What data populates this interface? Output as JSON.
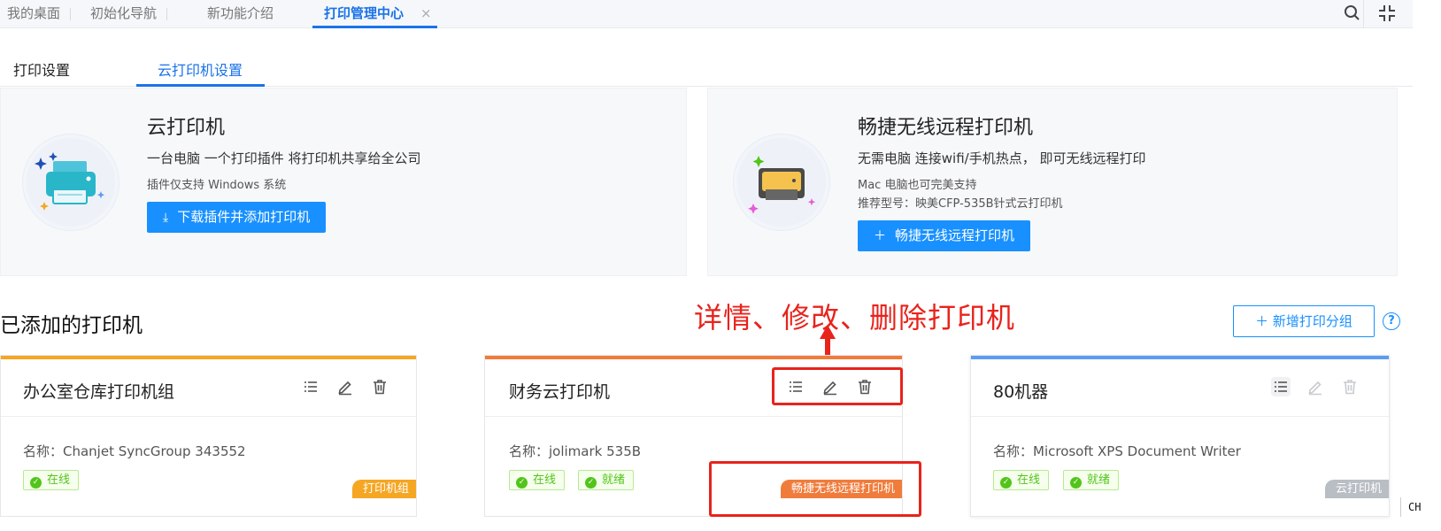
{
  "top_tabs": [
    {
      "label": "我的桌面",
      "active": false
    },
    {
      "label": "初始化导航",
      "active": false
    },
    {
      "label": "新功能介绍",
      "active": false
    },
    {
      "label": "打印管理中心",
      "active": true
    }
  ],
  "top_tab_close": "×",
  "top_icons": [
    "search-icon",
    "fullscreen-exit-icon"
  ],
  "sub_tabs": [
    {
      "label": "打印设置",
      "active": false
    },
    {
      "label": "云打印机设置",
      "active": true
    }
  ],
  "promos": {
    "cloud": {
      "title": "云打印机",
      "desc": "一台电脑 一个打印插件 将打印机共享给全公司",
      "note": "插件仅支持 Windows 系统",
      "button": "下载插件并添加打印机",
      "button_icon": "download-icon"
    },
    "wireless": {
      "title": "畅捷无线远程打印机",
      "desc": "无需电脑 连接wifi/手机热点， 即可无线远程打印",
      "note1": "Mac 电脑也可完美支持",
      "note2": "推荐型号：映美CFP-535B针式云打印机",
      "button": "畅捷无线远程打印机",
      "button_icon": "plus-icon"
    }
  },
  "section_title": "已添加的打印机",
  "annotation": "详情、修改、删除打印机",
  "add_group_button": "新增打印分组",
  "help_icon": "?",
  "cards": [
    {
      "title": "办公室仓库打印机组",
      "name": "名称：Chanjet SyncGroup 343552",
      "badges": [
        "在线"
      ],
      "tag": "打印机组",
      "accent": "#f5a623",
      "tag_color": "#f5a623"
    },
    {
      "title": "财务云打印机",
      "name": "名称：jolimark 535B",
      "badges": [
        "在线",
        "就绪"
      ],
      "tag": "畅捷无线远程打印机",
      "accent": "#f07c3c",
      "tag_color": "#f07c3c"
    },
    {
      "title": "80机器",
      "name": "名称：Microsoft XPS Document Writer",
      "badges": [
        "在线",
        "就绪"
      ],
      "tag": "云打印机",
      "accent": "#5b9cf0",
      "tag_color": "#b9bdc4"
    }
  ],
  "ime_indicator": "CH",
  "colors": {
    "primary": "#1890ff",
    "annotation_red": "#e8231c",
    "success": "#52c41a"
  }
}
